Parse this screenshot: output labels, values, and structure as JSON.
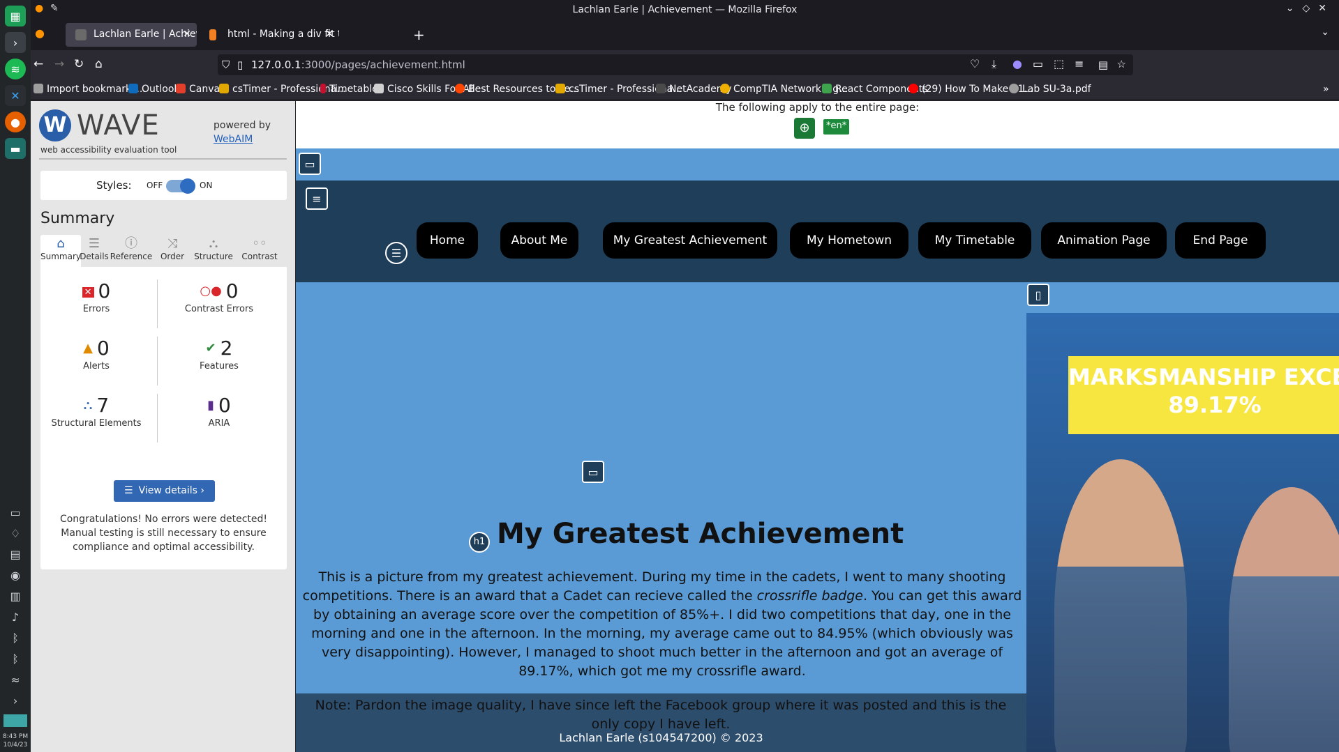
{
  "window": {
    "title": "Lachlan Earle | Achievement — Mozilla Firefox"
  },
  "tabs": [
    {
      "label": "Lachlan Earle | Achievement"
    },
    {
      "label": "html - Making a div fit the"
    }
  ],
  "urlbar": {
    "host": "127.0.0.1",
    "path": ":3000/pages/achievement.html"
  },
  "bookmarks": [
    {
      "label": "Import bookmarks...",
      "color": "#9e9e9e"
    },
    {
      "label": "Outlook",
      "color": "#0f6cbd"
    },
    {
      "label": "Canvas",
      "color": "#e13f2b"
    },
    {
      "label": "csTimer - Professiona...",
      "color": "#e0a800"
    },
    {
      "label": "Timetable",
      "color": "#c8102e"
    },
    {
      "label": "Cisco Skills For All",
      "color": "#d0d0d0"
    },
    {
      "label": "Best Resources to Le...",
      "color": "#ff4500"
    },
    {
      "label": "csTimer - Professiona...",
      "color": "#e0a800"
    },
    {
      "label": "NetAcademy",
      "color": "#4a4a4a"
    },
    {
      "label": "CompTIA Network+ g...",
      "color": "#f0b000"
    },
    {
      "label": "React Components",
      "color": "#3fa34d"
    },
    {
      "label": "(29) How To Make $1...",
      "color": "#ff0000"
    },
    {
      "label": "Lab SU-3a.pdf",
      "color": "#9e9e9e"
    }
  ],
  "wave": {
    "brand": "WAVE",
    "tagline": "web accessibility evaluation tool",
    "powered_by": "powered by",
    "webaim": "WebAIM",
    "styles_label": "Styles:",
    "styles_off": "OFF",
    "styles_on": "ON",
    "summary_title": "Summary",
    "tabs": [
      {
        "label": "Summary",
        "icon": "home-icon"
      },
      {
        "label": "Details",
        "icon": "list-icon"
      },
      {
        "label": "Reference",
        "icon": "info-icon"
      },
      {
        "label": "Order",
        "icon": "order-icon"
      },
      {
        "label": "Structure",
        "icon": "structure-icon"
      },
      {
        "label": "Contrast",
        "icon": "contrast-icon"
      }
    ],
    "stats": {
      "errors": {
        "value": "0",
        "label": "Errors"
      },
      "contrast_errors": {
        "value": "0",
        "label": "Contrast Errors"
      },
      "alerts": {
        "value": "0",
        "label": "Alerts"
      },
      "features": {
        "value": "2",
        "label": "Features"
      },
      "structural": {
        "value": "7",
        "label": "Structural Elements"
      },
      "aria": {
        "value": "0",
        "label": "ARIA"
      }
    },
    "view_details": "View details ›",
    "congrats": "Congratulations! No errors were detected! Manual testing is still necessary to ensure compliance and optimal accessibility."
  },
  "page": {
    "apply_text": "The following apply to the entire page:",
    "lang_badge": "*en*",
    "nav": [
      "Home",
      "About Me",
      "My Greatest Achievement",
      "My Hometown",
      "My Timetable",
      "Animation Page",
      "End Page"
    ],
    "h1_badge": "h1",
    "heading": "My Greatest Achievement",
    "paragraph_1": "This is a picture from my greatest achievement. During my time in the cadets, I went to many shooting competitions. There is an award that a Cadet can recieve called the ",
    "paragraph_em": "crossrifle badge",
    "paragraph_2": ". You can get this award by obtaining an average score over the competition of 85%+. I did two competitions that day, one in the morning and one in the afternoon. In the morning, my average came out to 84.95% (which obviously was very disappointing). However, I managed to shoot much better in the afternoon and got an average of 89.17%, which got me my crossrifle award.",
    "note": "Note: Pardon the image quality, I have since left the Facebook group where it was posted and this is the only copy I have left.",
    "footer": "Lachlan Earle (s104547200) © 2023",
    "banner_line1": "MARKSMANSHIP EXCELLEN",
    "banner_line2": "89.17%"
  },
  "clock": {
    "time": "8:43 PM",
    "date": "10/4/23"
  }
}
